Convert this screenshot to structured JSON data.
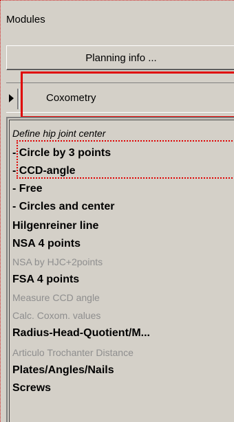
{
  "panel": {
    "title": "Modules",
    "planning_button": "Planning info ...",
    "module_selector": {
      "label": "Coxometry",
      "expand_icon": "triangle-right-icon"
    }
  },
  "list": {
    "items": [
      {
        "label": "Define hip joint center",
        "style": "italic"
      },
      {
        "label": " - Circle by 3 points",
        "style": "bold"
      },
      {
        "label": " - CCD-angle",
        "style": "bold"
      },
      {
        "label": " - Free",
        "style": "bold"
      },
      {
        "label": " - Circles and center",
        "style": "bold"
      },
      {
        "label": "Hilgenreiner line",
        "style": "bold"
      },
      {
        "label": "NSA 4 points",
        "style": "bold"
      },
      {
        "label": "NSA by HJC+2points",
        "style": "gray"
      },
      {
        "label": "FSA 4 points",
        "style": "bold"
      },
      {
        "label": "Measure CCD angle",
        "style": "gray"
      },
      {
        "label": "Calc. Coxom. values",
        "style": "gray"
      },
      {
        "label": "Radius-Head-Quotient/M...",
        "style": "bold"
      },
      {
        "label": "Articulo Trochanter Distance",
        "style": "gray"
      },
      {
        "label": "Plates/Angles/Nails",
        "style": "bold"
      },
      {
        "label": "Screws",
        "style": "bold"
      }
    ]
  },
  "colors": {
    "highlight": "#e00000",
    "disabled_text": "#8e8e8e",
    "background": "#d4d0c8"
  }
}
